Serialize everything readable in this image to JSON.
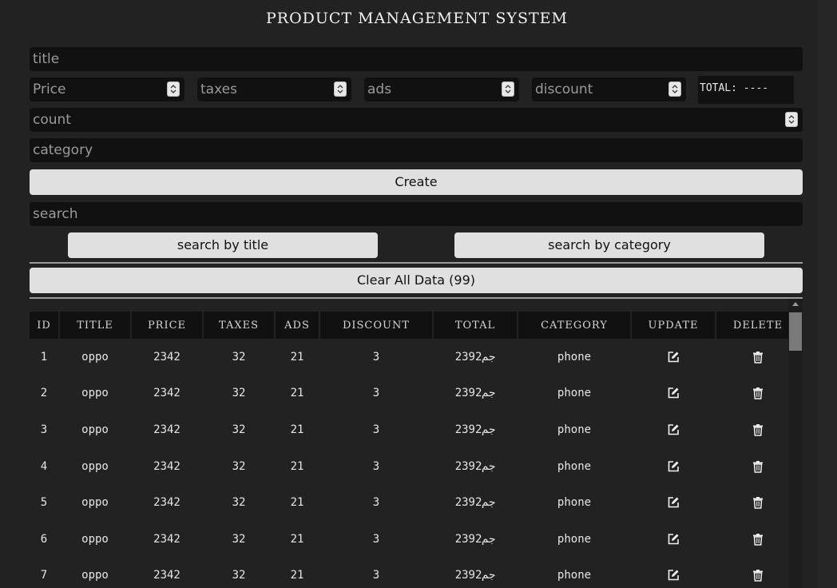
{
  "page": {
    "title": "PRODUCT MANAGEMENT SYSTEM"
  },
  "form": {
    "title_placeholder": "title",
    "price_placeholder": "Price",
    "taxes_placeholder": "taxes",
    "ads_placeholder": "ads",
    "discount_placeholder": "discount",
    "total_label": "TOTAL: ----",
    "count_placeholder": "count",
    "category_placeholder": "category",
    "create_label": "Create"
  },
  "search": {
    "placeholder": "search",
    "by_title_label": "search by title",
    "by_category_label": "search by category"
  },
  "clear_label": "Clear All Data (99)",
  "table": {
    "headers": [
      "ID",
      "TITLE",
      "PRICE",
      "TAXES",
      "ADS",
      "DISCOUNT",
      "TOTAL",
      "CATEGORY",
      "UPDATE",
      "DELETE"
    ],
    "rows": [
      {
        "id": "1",
        "title": "oppo",
        "price": "2342",
        "taxes": "32",
        "ads": "21",
        "discount": "3",
        "total": "2392جم",
        "category": "phone"
      },
      {
        "id": "2",
        "title": "oppo",
        "price": "2342",
        "taxes": "32",
        "ads": "21",
        "discount": "3",
        "total": "2392جم",
        "category": "phone"
      },
      {
        "id": "3",
        "title": "oppo",
        "price": "2342",
        "taxes": "32",
        "ads": "21",
        "discount": "3",
        "total": "2392جم",
        "category": "phone"
      },
      {
        "id": "4",
        "title": "oppo",
        "price": "2342",
        "taxes": "32",
        "ads": "21",
        "discount": "3",
        "total": "2392جم",
        "category": "phone"
      },
      {
        "id": "5",
        "title": "oppo",
        "price": "2342",
        "taxes": "32",
        "ads": "21",
        "discount": "3",
        "total": "2392جم",
        "category": "phone"
      },
      {
        "id": "6",
        "title": "oppo",
        "price": "2342",
        "taxes": "32",
        "ads": "21",
        "discount": "3",
        "total": "2392جم",
        "category": "phone"
      },
      {
        "id": "7",
        "title": "oppo",
        "price": "2342",
        "taxes": "32",
        "ads": "21",
        "discount": "3",
        "total": "2392جم",
        "category": "phone"
      }
    ],
    "update_icon": "edit-icon",
    "delete_icon": "trash-icon"
  }
}
